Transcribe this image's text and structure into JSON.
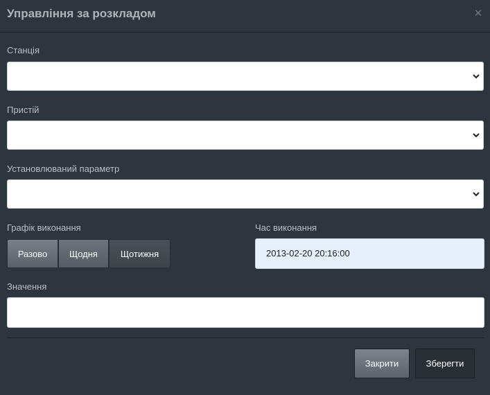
{
  "header": {
    "title": "Управління за розкладом"
  },
  "fields": {
    "station_label": "Станція",
    "device_label": "Пристій",
    "parameter_label": "Установлюваний параметр",
    "schedule_label": "Графік виконання",
    "time_label": "Час виконання",
    "value_label": "Значення"
  },
  "schedule": {
    "options": [
      "Разово",
      "Щодня",
      "Щотижня"
    ]
  },
  "time": {
    "value": "2013-02-20 20:16:00"
  },
  "footer": {
    "close_label": "Закрити",
    "save_label": "Зберегти"
  },
  "icons": {
    "close": "close-icon",
    "chevron": "chevron-down-icon"
  },
  "colors": {
    "background": "#2f353c",
    "input_highlight": "#e7effb"
  }
}
